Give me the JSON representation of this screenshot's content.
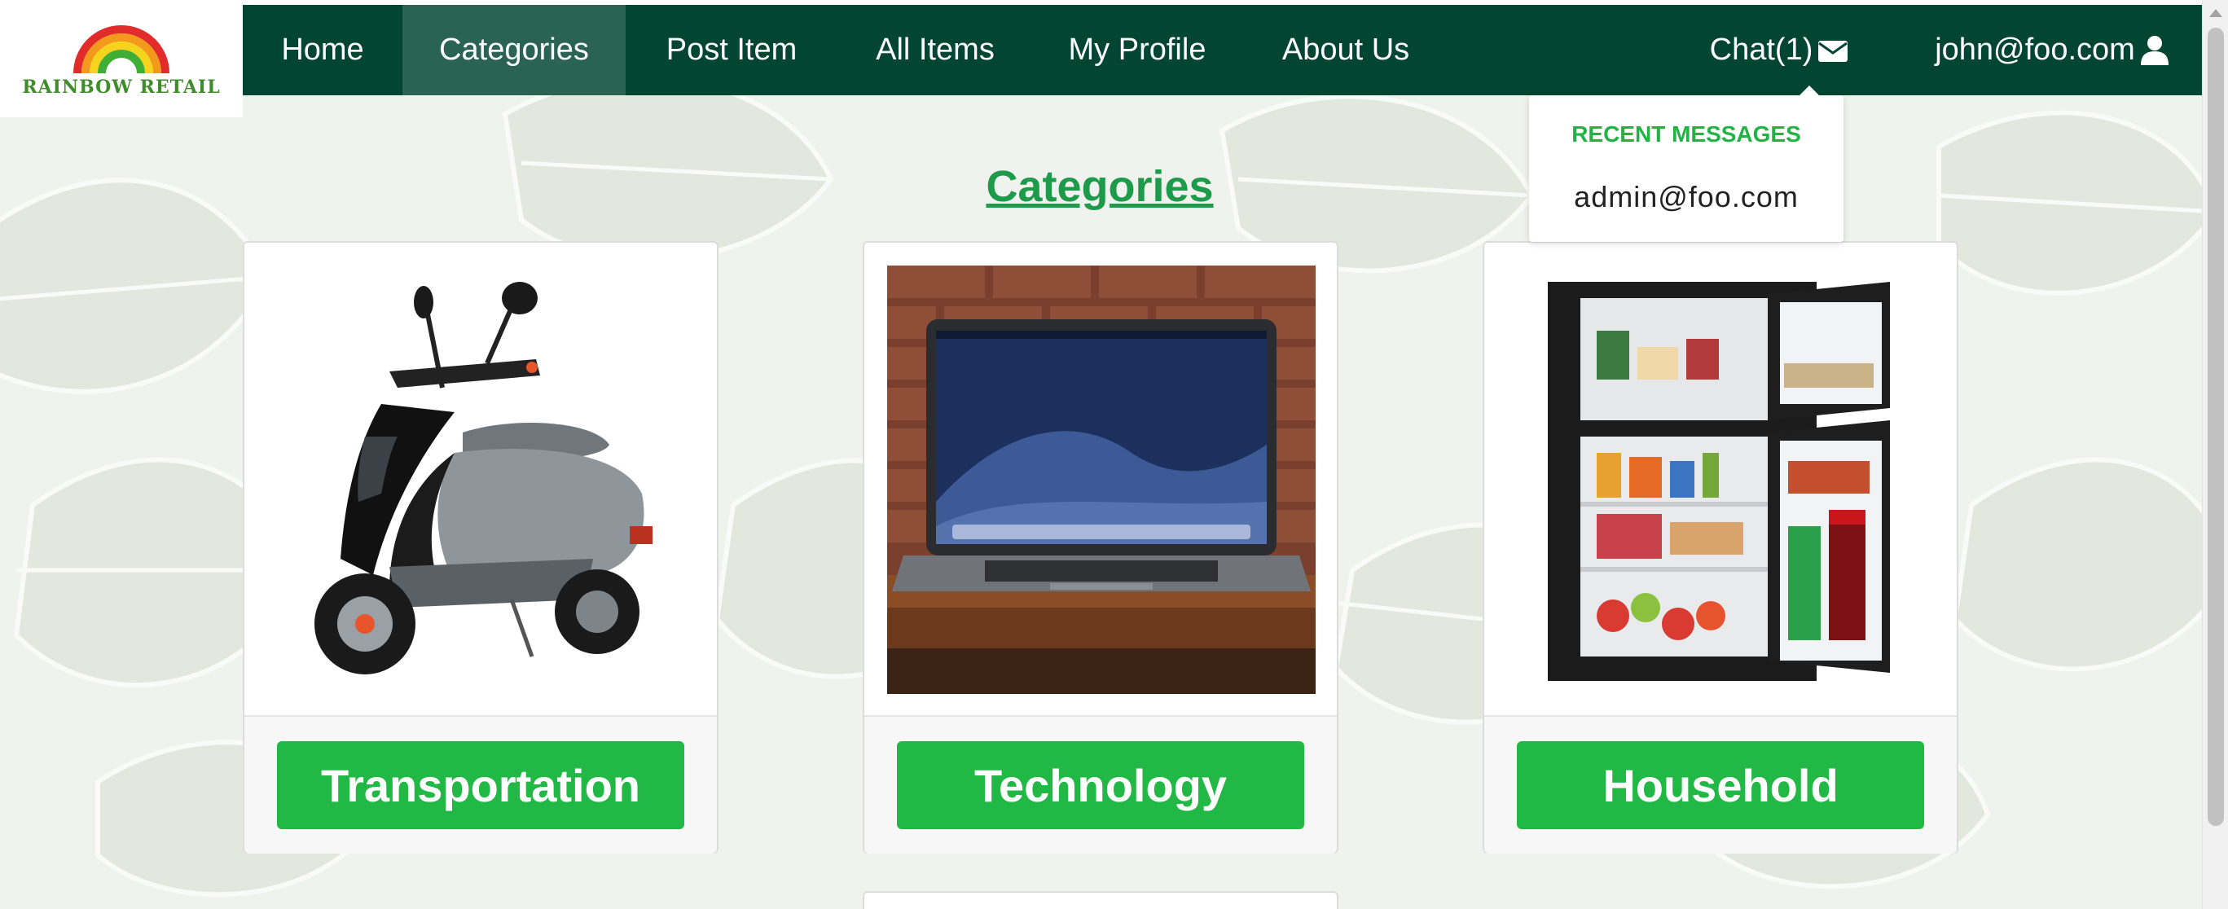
{
  "brand": {
    "logo_text": "RAINBOW RETAIL",
    "colors": [
      "#e22b2b",
      "#f39a1d",
      "#f6d31c",
      "#3fae34"
    ]
  },
  "nav": {
    "items": [
      {
        "label": "Home"
      },
      {
        "label": "Categories",
        "active": true
      },
      {
        "label": "Post Item"
      },
      {
        "label": "All Items"
      },
      {
        "label": "My Profile"
      },
      {
        "label": "About Us"
      }
    ],
    "chat_label": "Chat(1)",
    "user_label": "john@foo.com",
    "chat_icon": "envelope-icon",
    "user_icon": "user-icon"
  },
  "dropdown": {
    "header": "RECENT MESSAGES",
    "items": [
      "admin@foo.com"
    ]
  },
  "page": {
    "title": "Categories"
  },
  "categories": [
    {
      "label": "Transportation",
      "image": "scooter"
    },
    {
      "label": "Technology",
      "image": "laptop"
    },
    {
      "label": "Household",
      "image": "refrigerator"
    }
  ],
  "theme": {
    "nav_bg": "#024530",
    "nav_active": "#2a6351",
    "button_green": "#22b845",
    "title_green": "#1e9a4b"
  }
}
